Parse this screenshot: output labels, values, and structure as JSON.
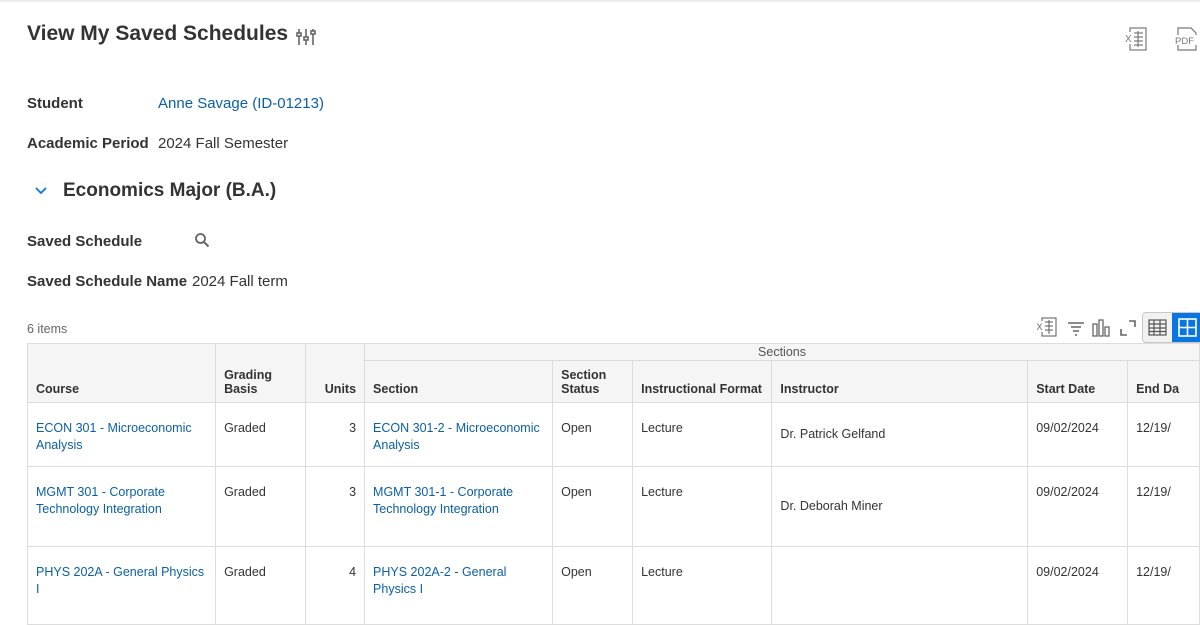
{
  "page": {
    "title": "View My Saved Schedules",
    "export_excel_icon": "excel-export-icon",
    "export_pdf_icon": "pdf-export-icon",
    "pdf_label": "PDF"
  },
  "student": {
    "label": "Student",
    "value": "Anne Savage (ID-01213)"
  },
  "academic_period": {
    "label": "Academic Period",
    "value": "2024 Fall Semester"
  },
  "program": {
    "title": "Economics Major (B.A.)"
  },
  "saved_schedule": {
    "label": "Saved Schedule",
    "name_label": "Saved Schedule Name",
    "name_value": "2024 Fall term"
  },
  "grid": {
    "count": "6 items",
    "group_header": "Sections",
    "columns": {
      "course": "Course",
      "grading": "Grading Basis",
      "units": "Units",
      "section": "Section",
      "status": "Section Status",
      "format": "Instructional Format",
      "instructor": "Instructor",
      "start": "Start Date",
      "end": "End Da"
    },
    "rows": [
      {
        "course": "ECON 301 - Microeconomic Analysis",
        "grading": "Graded",
        "units": "3",
        "section": "ECON 301-2 - Microeconomic Analysis",
        "status": "Open",
        "format": "Lecture",
        "instructor": "Dr. Patrick Gelfand",
        "start": "09/02/2024",
        "end": "12/19/"
      },
      {
        "course": "MGMT 301 - Corporate Technology Integration",
        "grading": "Graded",
        "units": "3",
        "section": "MGMT 301-1 - Corporate Technology Integration",
        "status": "Open",
        "format": "Lecture",
        "instructor": "Dr. Deborah Miner",
        "start": "09/02/2024",
        "end": "12/19/"
      },
      {
        "course": "PHYS 202A - General Physics I",
        "grading": "Graded",
        "units": "4",
        "section": "PHYS 202A-2 - General Physics I",
        "status": "Open",
        "format": "Lecture",
        "instructor": "",
        "start": "09/02/2024",
        "end": "12/19/"
      }
    ]
  },
  "colors": {
    "link": "#0b5fa5",
    "accent": "#0875e1",
    "header_bg": "#f5f5f5"
  }
}
